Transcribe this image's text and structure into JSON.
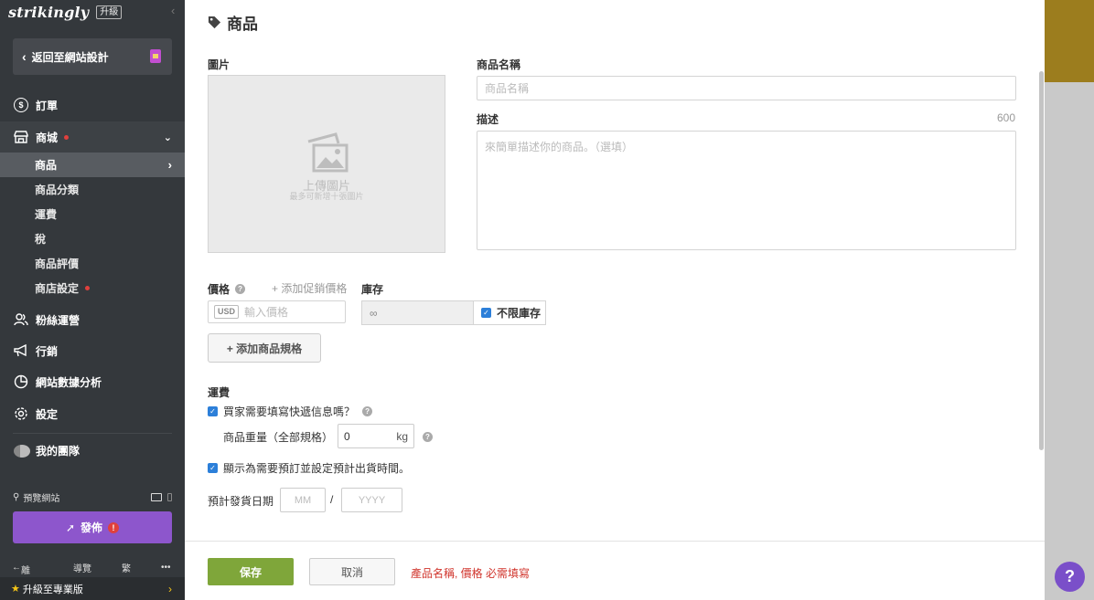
{
  "sidebar": {
    "logo": "strikingly",
    "upgrade_badge": "升級",
    "collapse_icon": "‹",
    "back_label": "返回至網站設計",
    "nav": {
      "orders": "訂單",
      "store": "商城",
      "fans": "粉絲運營",
      "marketing": "行銷",
      "analytics": "網站數據分析",
      "settings": "設定",
      "team": "我的團隊"
    },
    "sub_items": {
      "products": "商品",
      "categories": "商品分類",
      "shipping": "運費",
      "tax": "稅",
      "reviews": "商品評價",
      "store_settings": "商店設定"
    },
    "preview_label": "預覽網站",
    "publish_label": "發佈",
    "bottom": {
      "leave": "離開",
      "guide": "導覽",
      "lang": "繁",
      "more": "•••"
    },
    "upgrade_pro": "升級至專業版"
  },
  "panel": {
    "title": "商品",
    "image_label": "圖片",
    "upload_text": "上傳圖片",
    "upload_hint": "最多可新增十張圖片",
    "name_label": "商品名稱",
    "name_placeholder": "商品名稱",
    "desc_label": "描述",
    "desc_counter": "600",
    "desc_placeholder": "來簡單描述你的商品。（選填）",
    "price_label": "價格",
    "add_sale_price": "+ 添加促銷價格",
    "currency": "USD",
    "price_placeholder": "輸入價格",
    "stock_label": "庫存",
    "stock_value": "∞",
    "unlimited_stock": "不限庫存",
    "add_variant": "+ 添加商品規格",
    "shipping_label": "運費",
    "require_shipping_info": "買家需要填寫快遞信息嗎？",
    "weight_label": "商品重量（全部規格）",
    "weight_value": "0",
    "weight_unit": "kg",
    "preorder_label": "顯示為需要預訂並設定預計出貨時間。",
    "ship_date_label": "預計發貨日期",
    "month_placeholder": "MM",
    "date_separator": "/",
    "year_placeholder": "YYYY",
    "save": "保存",
    "cancel": "取消",
    "error": "產品名稱, 價格 必需填寫"
  },
  "help_fab": "?",
  "colors": {
    "sidebar_bg": "#34383c",
    "publish": "#8d56cc",
    "save": "#7fa63a",
    "error": "#d0342c",
    "checkbox": "#2c7fd9"
  }
}
